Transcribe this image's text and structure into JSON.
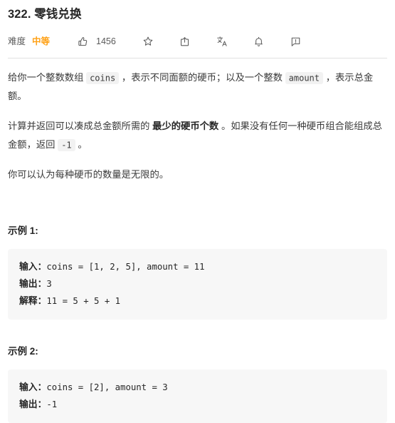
{
  "problem": {
    "title": "322. 零钱兑换",
    "difficulty_label": "难度",
    "difficulty_value": "中等",
    "difficulty_color": "#ffa116"
  },
  "toolbar": {
    "like_icon": "thumbs-up-icon",
    "like_count": "1456",
    "favorite_icon": "star-icon",
    "share_icon": "share-icon",
    "translate_icon": "translate-icon",
    "notification_icon": "bell-icon",
    "report_icon": "report-icon"
  },
  "description": {
    "p1_part1": "给你一个整数数组",
    "p1_code1": "coins",
    "p1_part2": "，表示不同面额的硬币；以及一个整数",
    "p1_code2": "amount",
    "p1_part3": "，表示总金额。",
    "p2_part1": "计算并返回可以凑成总金额所需的",
    "p2_bold": "最少的硬币个数",
    "p2_part2": "。如果没有任何一种硬币组合能组成总金额，返回",
    "p2_code1": "-1",
    "p2_part3": "。",
    "p3": "你可以认为每种硬币的数量是无限的。"
  },
  "examples": [
    {
      "heading": "示例 1:",
      "lines": [
        {
          "key": "输入：",
          "value": "coins = [1, 2, 5], amount = 11"
        },
        {
          "key": "输出：",
          "value": "3"
        },
        {
          "key": "解释：",
          "value": "11 = 5 + 5 + 1"
        }
      ]
    },
    {
      "heading": "示例 2:",
      "lines": [
        {
          "key": "输入：",
          "value": "coins = [2], amount = 3"
        },
        {
          "key": "输出：",
          "value": "-1"
        }
      ]
    }
  ]
}
